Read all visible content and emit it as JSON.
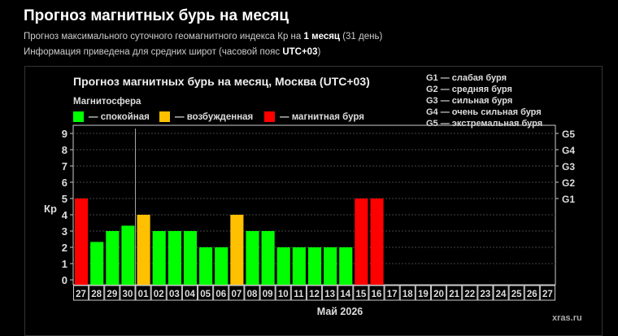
{
  "header": {
    "title": "Прогноз магнитных бурь на месяц",
    "line1_a": "Прогноз максимального суточного геомагнитного индекса Кр на ",
    "line1_b": "1 месяц",
    "line1_c": " (31 день)",
    "line2_a": "Информация приведена для средних широт (часовой пояс ",
    "line2_b": "UTC+03",
    "line2_c": ")"
  },
  "legend": {
    "title": "Магнитосфера",
    "items": [
      {
        "label": "— спокойная",
        "color": "#00ff00"
      },
      {
        "label": "— возбужденная",
        "color": "#ffc000"
      },
      {
        "label": "— магнитная буря",
        "color": "#ff0000"
      }
    ]
  },
  "g_legend": [
    "G1 — слабая буря",
    "G2 — средняя буря",
    "G3 — сильная буря",
    "G4 — очень сильная буря",
    "G5 — экстремальная буря"
  ],
  "source": "xras.ru",
  "chart_data": {
    "type": "bar",
    "title": "Прогноз магнитных бурь на месяц, Москва (UTC+03)",
    "xlabel": "Май 2026",
    "ylabel": "Кр",
    "ylim": [
      0,
      9
    ],
    "yticks": [
      "0",
      "1",
      "2",
      "3",
      "4",
      "5",
      "6",
      "7",
      "8",
      "9"
    ],
    "right_ticks": [
      {
        "kp": 5,
        "label": "G1"
      },
      {
        "kp": 6,
        "label": "G2"
      },
      {
        "kp": 7,
        "label": "G3"
      },
      {
        "kp": 8,
        "label": "G4"
      },
      {
        "kp": 9,
        "label": "G5"
      }
    ],
    "categories": [
      "27",
      "28",
      "29",
      "30",
      "01",
      "02",
      "03",
      "04",
      "05",
      "06",
      "07",
      "08",
      "09",
      "10",
      "11",
      "12",
      "13",
      "14",
      "15",
      "16",
      "17",
      "18",
      "19",
      "20",
      "21",
      "22",
      "23",
      "24",
      "25",
      "26",
      "27"
    ],
    "values": [
      5,
      2.33,
      3,
      3.33,
      4,
      3,
      3,
      3,
      2,
      2,
      4,
      3,
      3,
      2,
      2,
      2,
      2,
      2,
      5,
      5,
      null,
      null,
      null,
      null,
      null,
      null,
      null,
      null,
      null,
      null,
      null
    ],
    "today_marker_after": "30"
  }
}
